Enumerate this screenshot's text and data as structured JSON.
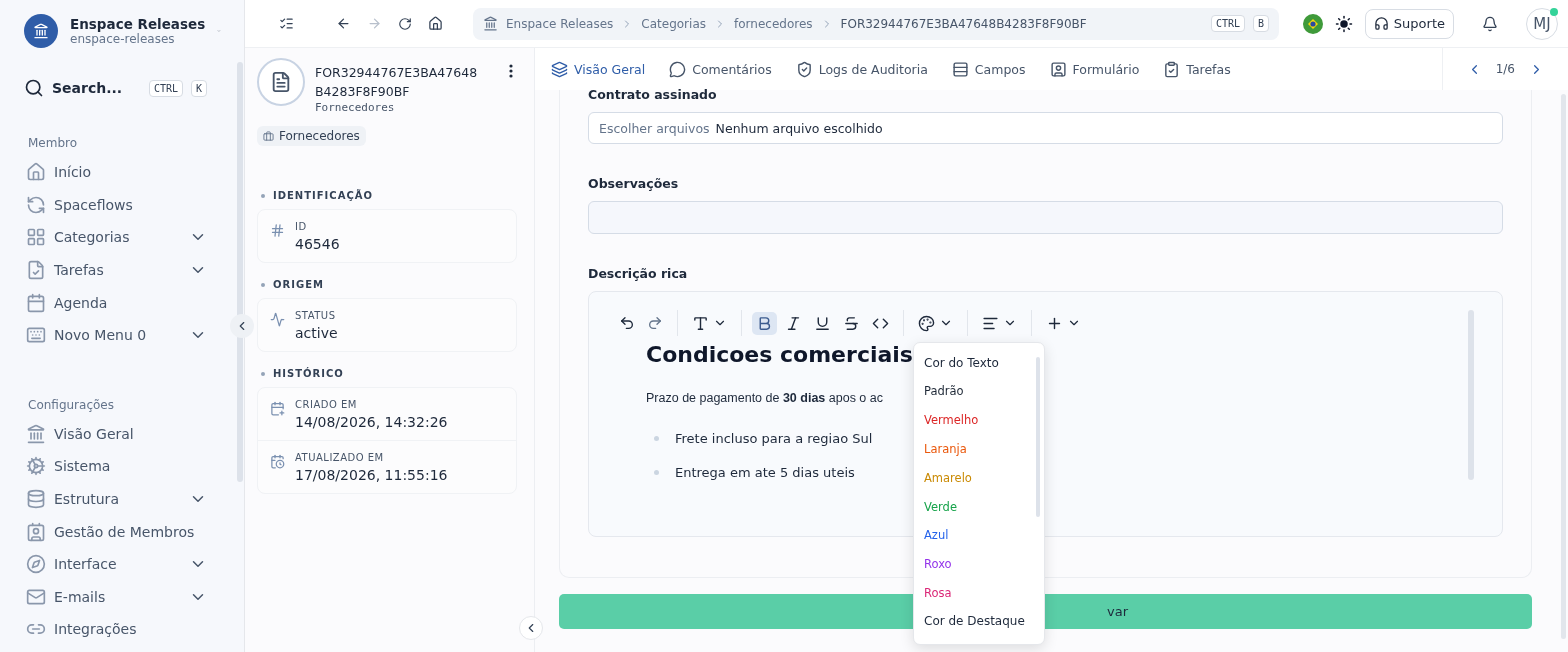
{
  "workspace": {
    "name": "Enspace Releases",
    "slug": "enspace-releases"
  },
  "search": {
    "placeholder": "Search...",
    "keys": [
      "CTRL",
      "K"
    ]
  },
  "sidebar": {
    "sections": [
      {
        "title": "Membro",
        "items": [
          {
            "label": "Início",
            "expandable": false
          },
          {
            "label": "Spaceflows",
            "expandable": false
          },
          {
            "label": "Categorias",
            "expandable": true
          },
          {
            "label": "Tarefas",
            "expandable": true
          },
          {
            "label": "Agenda",
            "expandable": false
          },
          {
            "label": "Novo Menu 0",
            "expandable": true
          }
        ]
      },
      {
        "title": "Configurações",
        "items": [
          {
            "label": "Visão Geral",
            "expandable": false
          },
          {
            "label": "Sistema",
            "expandable": false
          },
          {
            "label": "Estrutura",
            "expandable": true
          },
          {
            "label": "Gestão de Membros",
            "expandable": false
          },
          {
            "label": "Interface",
            "expandable": true
          },
          {
            "label": "E-mails",
            "expandable": true
          },
          {
            "label": "Integrações",
            "expandable": false
          }
        ]
      }
    ]
  },
  "breadcrumb": {
    "items": [
      "Enspace Releases",
      "Categorias",
      "fornecedores",
      "FOR32944767E3BA47648B4283F8F90BF"
    ],
    "keys": [
      "CTRL",
      "B"
    ]
  },
  "topbar": {
    "support": "Suporte",
    "avatar": "MJ",
    "online": true
  },
  "record": {
    "title": "FOR32944767E3BA47648B4283F8F90BF",
    "subtitle": "Fornecedores",
    "tag": "Fornecedores",
    "sections": [
      {
        "title": "IDENTIFICAÇÃO",
        "fields": [
          {
            "kind": "hash",
            "label": "ID",
            "value": "46546"
          }
        ]
      },
      {
        "title": "ORIGEM",
        "fields": [
          {
            "kind": "activity",
            "label": "STATUS",
            "value": "active"
          }
        ]
      },
      {
        "title": "HISTÓRICO",
        "fields": [
          {
            "kind": "created",
            "label": "CRIADO EM",
            "value": "14/08/2026, 14:32:26"
          },
          {
            "kind": "updated",
            "label": "ATUALIZADO EM",
            "value": "17/08/2026, 11:55:16"
          }
        ]
      }
    ]
  },
  "tabs": [
    {
      "label": "Visão Geral",
      "selected": true
    },
    {
      "label": "Comentários",
      "selected": false
    },
    {
      "label": "Logs de Auditoria",
      "selected": false
    },
    {
      "label": "Campos",
      "selected": false
    },
    {
      "label": "Formulário",
      "selected": false
    },
    {
      "label": "Tarefas",
      "selected": false
    }
  ],
  "pager": "1/6",
  "form": {
    "file_field": {
      "label": "Contrato assinado",
      "button": "Escolher arquivos",
      "value": "Nenhum arquivo escolhido"
    },
    "notes_field": {
      "label": "Observações"
    },
    "editor": {
      "label": "Descrição rica",
      "format_buttons": [
        {
          "kind": "bold",
          "active": true
        },
        {
          "kind": "italic",
          "active": false
        },
        {
          "kind": "underline",
          "active": false
        },
        {
          "kind": "strike",
          "active": false
        },
        {
          "kind": "code",
          "active": false
        }
      ],
      "heading": "Condicoes comerciais",
      "paragraph": "Prazo de pagamento de **30 dias** apos o ac",
      "bullets": [
        "Frete incluso para a regiao Sul",
        "Entrega em ate 5 dias uteis"
      ]
    },
    "save": "var"
  },
  "color_menu": [
    {
      "kind": "header",
      "label": "Cor do Texto"
    },
    {
      "kind": "color",
      "label": "Padrão",
      "color": "#1f2937"
    },
    {
      "kind": "color",
      "label": "Vermelho",
      "color": "#dc2626"
    },
    {
      "kind": "color",
      "label": "Laranja",
      "color": "#ea580c"
    },
    {
      "kind": "color",
      "label": "Amarelo",
      "color": "#ca8a04"
    },
    {
      "kind": "color",
      "label": "Verde",
      "color": "#16a34a"
    },
    {
      "kind": "color",
      "label": "Azul",
      "color": "#2563eb"
    },
    {
      "kind": "color",
      "label": "Roxo",
      "color": "#9333ea"
    },
    {
      "kind": "color",
      "label": "Rosa",
      "color": "#db2777"
    },
    {
      "kind": "header",
      "label": "Cor de Destaque"
    }
  ]
}
